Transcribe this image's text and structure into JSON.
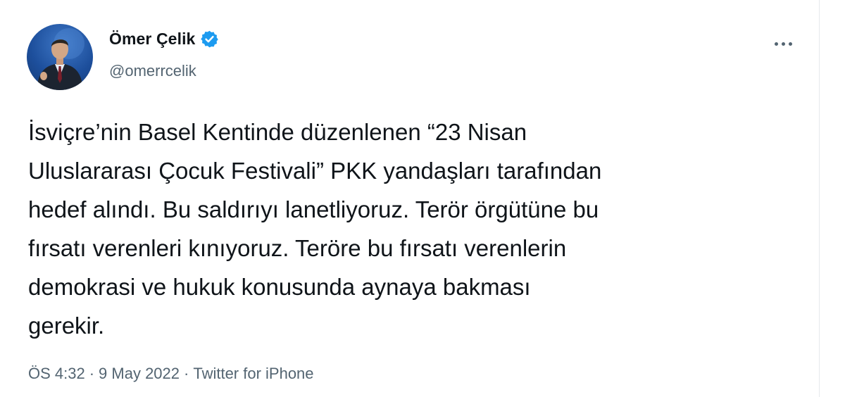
{
  "tweet": {
    "author": {
      "display_name": "Ömer Çelik",
      "handle": "@omerrcelik",
      "verified": true
    },
    "text_lines": [
      "İsviçre’nin Basel Kentinde düzenlenen “23 Nisan",
      "Uluslararası Çocuk Festivali” PKK yandaşları tarafından",
      "hedef alındı. Bu saldırıyı lanetliyoruz. Terör örgütüne bu",
      "fırsatı verenleri kınıyoruz. Teröre bu fırsatı verenlerin",
      "demokrasi ve hukuk konusunda aynaya bakması",
      "gerekir."
    ],
    "time": "ÖS 4:32",
    "date": "9 May 2022",
    "separator": "·",
    "source": "Twitter for iPhone"
  },
  "icons": {
    "verified": "verified-badge-icon",
    "more": "more-options-icon"
  },
  "colors": {
    "text": "#0f1419",
    "secondary": "#536471",
    "verified_blue": "#1d9bf0"
  }
}
